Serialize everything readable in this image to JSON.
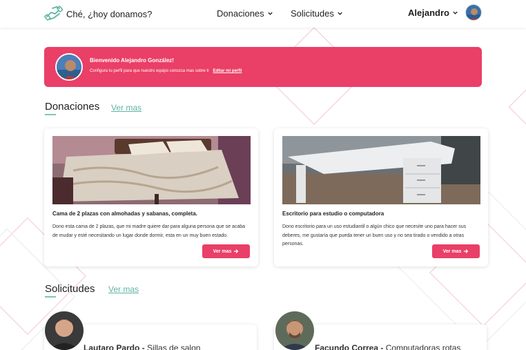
{
  "header": {
    "brand": "Ché, ¿hoy donamos?",
    "nav": [
      {
        "label": "Donaciones"
      },
      {
        "label": "Solicitudes"
      }
    ],
    "user_name": "Alejandro"
  },
  "banner": {
    "title": "Bienvenido Alejandro González!",
    "subtitle": "Configura tu perfil para que nuestro equipo conozca mas sobre ti",
    "link": "Editar mi perfil"
  },
  "donations": {
    "title": "Donaciones",
    "more": "Ver mas",
    "cards": [
      {
        "title": "Cama de 2 plazas con almohadas y sabanas, completa.",
        "desc": "Dono esta cama de 2 plazas, que mi madre quiere dar para alguna persona que se acaba de mudar y esté necesitando un lugar donde dormir, esta en un muy buen estado.",
        "button": "Ver mas"
      },
      {
        "title": "Escritorio para estudio o computadora",
        "desc": "Dono escritorio para un uso estudiantil o algún chico que necesite uno para hacer sus deberes, me gustaría que pueda tener un buen uso y no sea tirado o vendido a otras personas.",
        "button": "Ver mas"
      }
    ]
  },
  "requests": {
    "title": "Solicitudes",
    "more": "Ver mas",
    "items": [
      {
        "name": "Lautaro Pardo -",
        "item": "Sillas de salon"
      },
      {
        "name": "Facundo Correa -",
        "item": "Computadoras rotas"
      }
    ]
  },
  "colors": {
    "accent": "#ea3f66",
    "link": "#5fb3a1"
  },
  "icons": [
    "hands-logo-icon",
    "chevron-down-icon",
    "arrow-right-icon"
  ]
}
